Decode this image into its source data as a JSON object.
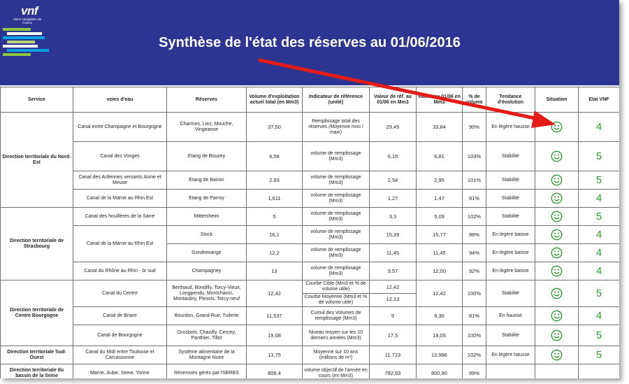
{
  "logo": {
    "brand": "vnf",
    "subtitle": "Voies navigables de France",
    "stripe_colors": [
      "#8cc63f",
      "#ffffff",
      "#00a3e0",
      "#b7d77a",
      "#ffffff",
      "#00a3e0",
      "#8cc63f"
    ]
  },
  "title": "Synthèse de l'état des réserves au 01/06/2016",
  "colors": {
    "banner": "#2d3592",
    "smiley": "#2e9c2e",
    "etat": "#2e9c2e",
    "arrow": "#e41b17"
  },
  "headers": {
    "service": "Service",
    "voies": "voies d'eau",
    "reserves": "Réserves",
    "volume": "Volume d'exploitation actuel total (en Mm3)",
    "indicateur": "Indicateur de référence (unité)",
    "valeur_ref": "Valeur de réf. au 01/06 en Mm3",
    "valeur_0106": "Valeur au 01/06 en Mm3",
    "pct": "% de volume",
    "tendance": "Tendance d'évolution",
    "situation": "Situation",
    "etat": "Etat VNF"
  },
  "services": [
    "Direction territoriale du Nord-Est",
    "Direction territoriale de Strasbourg",
    "Direction territoriale de Centre Bourgogne",
    "Direction territoriale Sud-Ouest",
    "Direction territoriale du bassin de la Seine"
  ],
  "rows": [
    {
      "voie": "Canal entre Champagne et Bourgogne",
      "reserve": "Charmes, Liez, Mouche, Vingeanne",
      "volume": "37,50",
      "indicateur": "Remplissage total des réserves (Moyenne mini / maxi)",
      "ref": "29,45",
      "val": "33,84",
      "pct": "90%",
      "tendance": "En légère hausse",
      "situation": "smiley",
      "etat": "4"
    },
    {
      "voie": "Canal des Vosges",
      "reserve": "Etang de Bouzey",
      "volume": "6,58",
      "indicateur": "volume de remplissage (Mm3)",
      "ref": "6,16",
      "val": "6,81",
      "pct": "103%",
      "tendance": "Stabilité",
      "situation": "smiley",
      "etat": "5"
    },
    {
      "voie": "Canal des Ardennes versants Aisne et Meuse",
      "reserve": "Etang de Bairon",
      "volume": "2,93",
      "indicateur": "volume de remplissage (Mm3)",
      "ref": "2,54",
      "val": "2,95",
      "pct": "101%",
      "tendance": "Stabilité",
      "situation": "smiley",
      "etat": "5"
    },
    {
      "voie": "Canal de la Marne au Rhin Est",
      "reserve": "Etang de Parroy",
      "volume": "1,611",
      "indicateur": "volume de remplissage (Mm3)",
      "ref": "1,27",
      "val": "1,47",
      "pct": "91%",
      "tendance": "Stabilité",
      "situation": "smiley",
      "etat": "4"
    },
    {
      "voie": "Canal des houillères de la Sarre",
      "reserve": "Mittersheim",
      "volume": "5",
      "indicateur": "volume de remplissage (Mm3)",
      "ref": "3,3",
      "val": "5,09",
      "pct": "102%",
      "tendance": "Stabilité",
      "situation": "smiley",
      "etat": "5"
    },
    {
      "voie": "Canal de la Marne au Rhin Est",
      "reserve": "Stock",
      "volume": "16,1",
      "indicateur": "volume de remplissage (Mm3)",
      "ref": "15,39",
      "val": "15,77",
      "pct": "98%",
      "tendance": "En légère baisse",
      "situation": "smiley",
      "etat": "4"
    },
    {
      "voie": "",
      "reserve": "Gondrexange",
      "volume": "12,2",
      "indicateur": "volume de remplissage (Mm3)",
      "ref": "11,45",
      "val": "11,45",
      "pct": "94%",
      "tendance": "En légère baisse",
      "situation": "smiley",
      "etat": "4"
    },
    {
      "voie": "Canal du Rhône au Rhin - br sud",
      "reserve": "Champagney",
      "volume": "13",
      "indicateur": "volume de remplissage (Mm3)",
      "ref": "9,57",
      "val": "12,00",
      "pct": "92%",
      "tendance": "En légère baisse",
      "situation": "smiley",
      "etat": "4"
    },
    {
      "voie": "Canal du Centre",
      "reserve": "Berthaud, Bondilly, Torcy-Vieux, Longpendu, Montchanin, Montaubry, Plessis, Torcy-neuf",
      "volume": "12,42",
      "indicateur": "Courbe Cible (Mm3 et % de volume utile)",
      "indicateur2": "Courbe Moyenne (Mm3 et % de volume utile)",
      "ref": "12,42",
      "ref2": "12,13",
      "val": "12,42",
      "pct": "100%",
      "tendance": "Stabilité",
      "situation": "smiley",
      "etat": "5"
    },
    {
      "voie": "Canal de Briare",
      "reserve": "Bourdon, Grand-Rue, Tuilerie",
      "volume": "11,537",
      "indicateur": "Cumul des Volumes de remplissage (Mm3)",
      "ref": "9",
      "val": "9,30",
      "pct": "81%",
      "tendance": "En hausse",
      "situation": "smiley",
      "etat": "4"
    },
    {
      "voie": "Canal de Bourgogne",
      "reserve": "Grosbois, Chazilly, Cercey, Panthier, Tillot",
      "volume": "19,08",
      "indicateur": "Niveau moyen sur les 10 derniers années (Mm3)",
      "ref": "17,5",
      "val": "19,05",
      "pct": "100%",
      "tendance": "Stabilité",
      "situation": "smiley",
      "etat": "5"
    },
    {
      "voie": "Canal du Midi entre Toulouse et Carcassonne",
      "reserve": "Système alimentaire de la Montagne Noire",
      "volume": "13,75",
      "indicateur": "Moyenne sur 10 ans (millions de m³)",
      "ref": "11,723",
      "val": "13,996",
      "pct": "102%",
      "tendance": "En légère hausse",
      "situation": "smiley",
      "etat": "5"
    },
    {
      "voie": "Marne, Aube, Seine, Yonne",
      "reserve": "Réservoirs gérés par l'IIBRBS",
      "volume": "806,4",
      "indicateur": "volume objectif de l'année en cours (en Mm3)",
      "ref": "782,93",
      "val": "800,90",
      "pct": "99%",
      "tendance": "",
      "situation": "",
      "etat": ""
    }
  ]
}
